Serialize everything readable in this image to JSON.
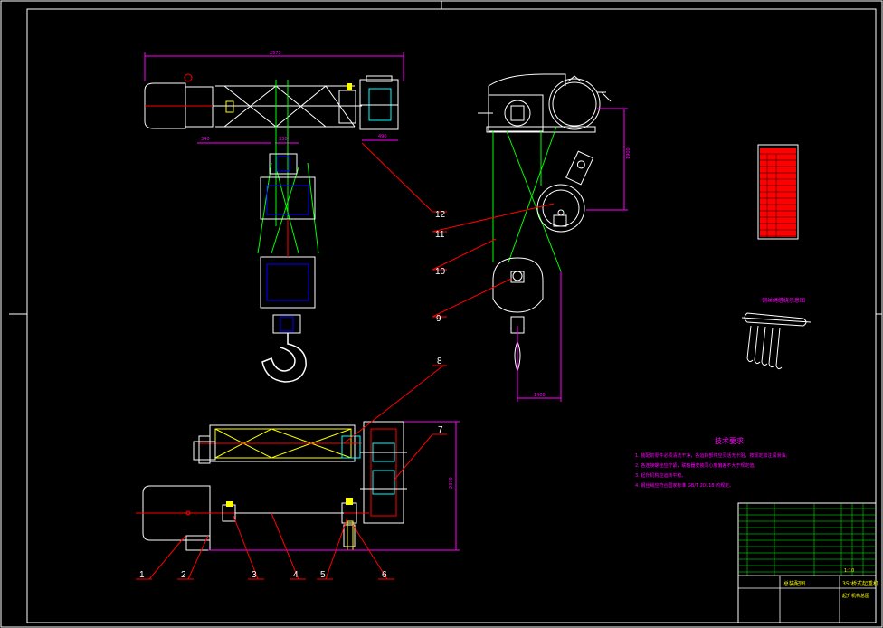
{
  "colors": {
    "background": "#000000",
    "frame": "#ffffff",
    "outline": "#ffffff",
    "leader": "#ff0000",
    "dimension": "#ff00ff",
    "construction": "#00ff00",
    "detail": "#ffff00",
    "cyan": "#00ffff",
    "blue": "#0000ff"
  },
  "top_view": {
    "dimension_total": "2573",
    "dimension_left": "340",
    "dimension_mid": "330",
    "dimension_right": "490"
  },
  "side_view": {
    "dimension_height": "1900",
    "dimension_width": "1400"
  },
  "front_view": {
    "dimension_height": "2370"
  },
  "part_callouts": [
    {
      "number": "12"
    },
    {
      "number": "11"
    },
    {
      "number": "10"
    },
    {
      "number": "9"
    },
    {
      "number": "8"
    },
    {
      "number": "7"
    },
    {
      "number": "1"
    },
    {
      "number": "2"
    },
    {
      "number": "3"
    },
    {
      "number": "4"
    },
    {
      "number": "5"
    },
    {
      "number": "6"
    }
  ],
  "tech_requirements": {
    "title": "技术要求",
    "lines": [
      "1. 装配前零件必须清洗干净，各运转部件应灵活无卡阻，按规定加注润滑油。",
      "2. 各连接螺栓应拧紧，联轴器安装同心度偏差不大于规定值。",
      "3. 起升机构应运转平稳。",
      "4. 钢丝绳应符合国家标准 GB/T 20118 的规定。"
    ]
  },
  "rope_diagram": {
    "title": "钢丝绳缠绕示意图"
  },
  "title_block": {
    "drawing_title": "35t桥式起重机",
    "drawing_subtitle": "起升机构总图",
    "assembly_label": "总装配图",
    "scale": "1:10"
  }
}
